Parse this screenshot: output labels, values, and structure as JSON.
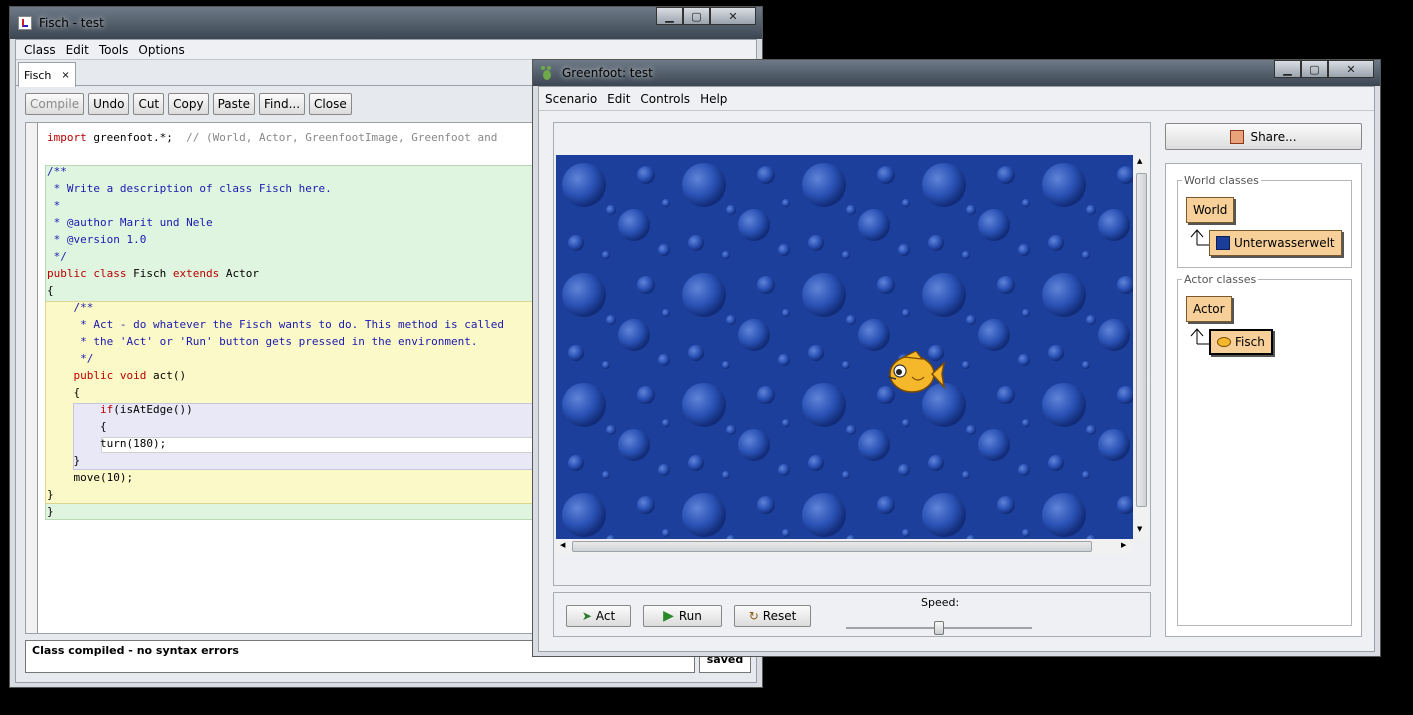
{
  "editor": {
    "title": "Fisch - test",
    "menu": [
      "Class",
      "Edit",
      "Tools",
      "Options"
    ],
    "tab": "Fisch",
    "tab_close": "×",
    "toolbar": [
      "Compile",
      "Undo",
      "Cut",
      "Copy",
      "Paste",
      "Find...",
      "Close"
    ],
    "code": {
      "l1_kw": "import",
      "l1_txt": " greenfoot.*;  ",
      "l1_comment": "// (World, Actor, GreenfootImage, Greenfoot and",
      "c1": "/**",
      "c2": " * Write a description of class Fisch here.",
      "c3": " *",
      "c4": " * @author Marit und Nele",
      "c5": " * @version 1.0",
      "c6": " */",
      "cls_kw1": "public class",
      "cls_name": " Fisch ",
      "cls_kw2": "extends",
      "cls_parent": " Actor",
      "brace_open": "{",
      "m1": "    /**",
      "m2": "     * Act - do whatever the Fisch wants to do. This method is called",
      "m3": "     * the 'Act' or 'Run' button gets pressed in the environment.",
      "m4": "     */",
      "m_kw": "    public void",
      "m_name": " act()",
      "m_open": "    {",
      "if_kw": "        if",
      "if_cond": "(isAtEdge())",
      "if_open": "        {",
      "turn": "        turn(180);",
      "if_close": "    }",
      "move": "    move(10);",
      "m_close": "}",
      "cls_close": "}"
    },
    "status": "Class compiled - no syntax errors",
    "saved": "saved"
  },
  "greenfoot": {
    "title": "Greenfoot: test",
    "menu": [
      "Scenario",
      "Edit",
      "Controls",
      "Help"
    ],
    "share_label": "Share...",
    "world_classes_label": "World classes",
    "world_classes": [
      "World",
      "Unterwasserwelt"
    ],
    "actor_classes_label": "Actor classes",
    "actor_classes": [
      "Actor",
      "Fisch"
    ],
    "controls": {
      "act": "Act",
      "run": "Run",
      "reset": "Reset",
      "speed_label": "Speed:",
      "speed_value": 0.5
    }
  },
  "colors": {
    "water": "#1a3d9a",
    "class_box": "#f6cf99",
    "comment_bg": "#e0f5df",
    "method_bg": "#fbf9c8",
    "if_bg": "#e8e8f6"
  }
}
